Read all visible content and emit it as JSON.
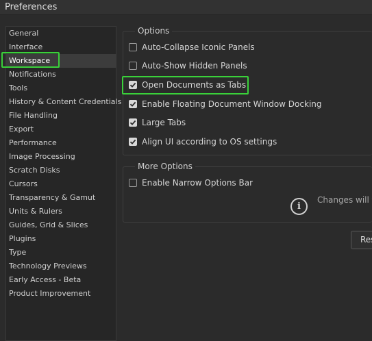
{
  "window": {
    "title": "Preferences"
  },
  "sidebar": {
    "items": [
      {
        "label": "General"
      },
      {
        "label": "Interface"
      },
      {
        "label": "Workspace",
        "selected": true
      },
      {
        "label": "Notifications"
      },
      {
        "label": "Tools"
      },
      {
        "label": "History & Content Credentials"
      },
      {
        "label": "File Handling"
      },
      {
        "label": "Export"
      },
      {
        "label": "Performance"
      },
      {
        "label": "Image Processing"
      },
      {
        "label": "Scratch Disks"
      },
      {
        "label": "Cursors"
      },
      {
        "label": "Transparency & Gamut"
      },
      {
        "label": "Units & Rulers"
      },
      {
        "label": "Guides, Grid & Slices"
      },
      {
        "label": "Plugins"
      },
      {
        "label": "Type"
      },
      {
        "label": "Technology Previews"
      },
      {
        "label": "Early Access - Beta"
      },
      {
        "label": "Product Improvement"
      }
    ]
  },
  "options": {
    "title": "Options",
    "items": [
      {
        "label": "Auto-Collapse Iconic Panels",
        "checked": false
      },
      {
        "label": "Auto-Show Hidden Panels",
        "checked": false
      },
      {
        "label": "Open Documents as Tabs",
        "checked": true
      },
      {
        "label": "Enable Floating Document Window Docking",
        "checked": true
      },
      {
        "label": "Large Tabs",
        "checked": true
      },
      {
        "label": "Align UI according to OS settings",
        "checked": true
      }
    ]
  },
  "more_options": {
    "title": "More Options",
    "items": [
      {
        "label": "Enable Narrow Options Bar",
        "checked": false
      }
    ],
    "info_text": "Changes will ta"
  },
  "reset_button": {
    "label": "Res"
  },
  "colors": {
    "background": "#2b2b2b",
    "highlight": "#3ad13a",
    "selected_item": "#3c3c3c"
  }
}
